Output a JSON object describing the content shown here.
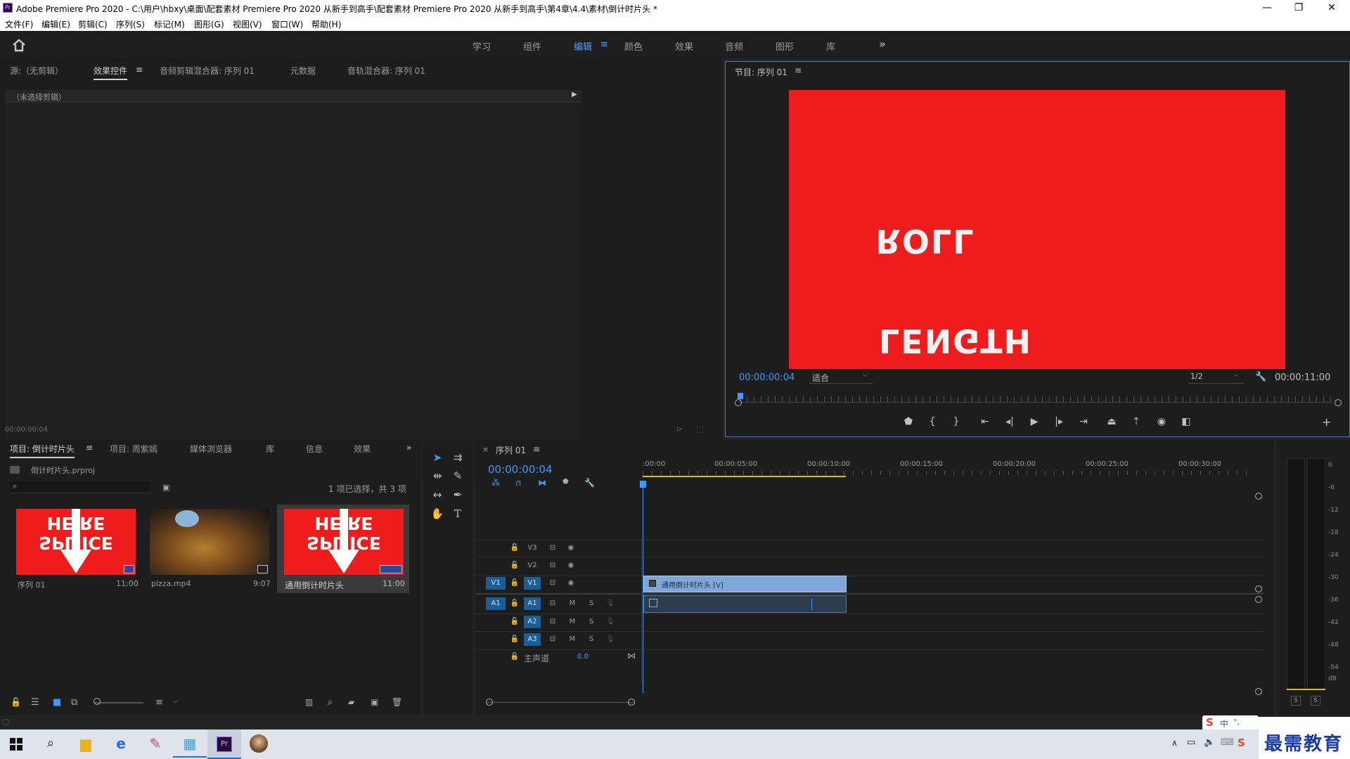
{
  "window": {
    "app_icon": "Pr",
    "title": "Adobe Premiere Pro 2020 - C:\\用户\\hbxy\\桌面\\配套素材 Premiere Pro 2020 从新手到高手\\配套素材 Premiere Pro 2020 从新手到高手\\第4章\\4.4\\素材\\倒计时片头 *",
    "minimize": "—",
    "restore": "❐",
    "close": "✕"
  },
  "menu": [
    "文件(F)",
    "编辑(E)",
    "剪辑(C)",
    "序列(S)",
    "标记(M)",
    "图形(G)",
    "视图(V)",
    "窗口(W)",
    "帮助(H)"
  ],
  "workspaces": {
    "items": [
      "学习",
      "组件",
      "编辑",
      "颜色",
      "效果",
      "音频",
      "图形",
      "库"
    ],
    "active": "编辑",
    "more": "»",
    "menu_icon": "≡"
  },
  "source_panel": {
    "tabs": [
      "源:（无剪辑）",
      "效果控件",
      "音频剪辑混合器: 序列 01",
      "元数据",
      "音轨混合器: 序列 01"
    ],
    "active_tab": "效果控件",
    "no_clip": "（未选择剪辑）",
    "timecode": "00:00:00:04"
  },
  "program_monitor": {
    "title": "节目: 序列 01",
    "frame_text_top": "ROLL",
    "frame_text_bottom": "LENGTH",
    "frame_color": "#ee1c1c",
    "timecode": "00:00:00:04",
    "fit": "适合",
    "resolution": "1/2",
    "duration": "00:00:11:00",
    "controls": [
      "marker-icon",
      "mark-in-icon",
      "mark-out-icon",
      "go-to-in-icon",
      "step-back-icon",
      "play-icon",
      "step-forward-icon",
      "go-to-out-icon",
      "lift-icon",
      "extract-icon",
      "export-frame-icon",
      "compare-icon"
    ],
    "add": "+"
  },
  "project_panel": {
    "tabs": [
      "项目: 倒计时片头",
      "项目: 周紫嫣",
      "媒体浏览器",
      "库",
      "信息",
      "效果"
    ],
    "active_tab": "项目: 倒计时片头",
    "more": "»",
    "file": "倒计时片头.prproj",
    "selection": "1 项已选择，共 3 项",
    "items": [
      {
        "name": "序列 01",
        "duration": "11:00",
        "thumb": "countdown"
      },
      {
        "name": "pizza.mp4",
        "duration": "9:07",
        "thumb": "pizza"
      },
      {
        "name": "通用倒计时片头",
        "duration": "11:00",
        "thumb": "countdown"
      }
    ],
    "thumb_text_top": "HE RE",
    "thumb_text_bottom": "SPL ICE"
  },
  "timeline": {
    "title": "序列 01",
    "close": "×",
    "timecode": "00:00:00:04",
    "ruler": [
      ":00:00",
      "00:00:05:00",
      "00:00:10:00",
      "00:00:15:00",
      "00:00:20:00",
      "00:00:25:00",
      "00:00:30:00"
    ],
    "video_tracks": [
      {
        "name": "V3"
      },
      {
        "name": "V2"
      },
      {
        "name": "V1",
        "source": "V1"
      }
    ],
    "audio_tracks": [
      {
        "name": "A1",
        "source": "A1"
      },
      {
        "name": "A2"
      },
      {
        "name": "A3"
      }
    ],
    "master": {
      "label": "主声道",
      "value": "0.0"
    },
    "clip_video": "通用倒计时片头 [V]",
    "mute": "M",
    "solo": "S"
  },
  "meter": {
    "scale": [
      "0",
      "-6",
      "-12",
      "-18",
      "-24",
      "-30",
      "-36",
      "-42",
      "-48",
      "-54",
      "dB"
    ],
    "solo": [
      "S",
      "S"
    ]
  },
  "taskbar": {
    "ime": "中",
    "brand": "最需教育"
  }
}
